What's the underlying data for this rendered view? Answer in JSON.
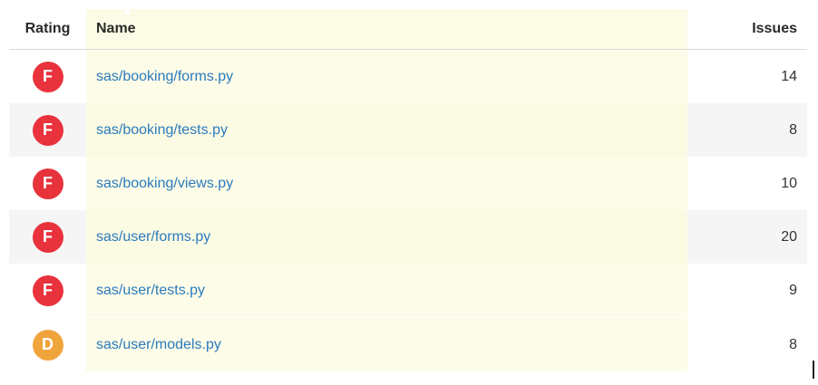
{
  "header": {
    "rating": "Rating",
    "name": "Name",
    "issues": "Issues"
  },
  "rows": [
    {
      "rating": "F",
      "rating_color": "#e8323c",
      "name": "sas/booking/forms.py",
      "issues": "14"
    },
    {
      "rating": "F",
      "rating_color": "#e8323c",
      "name": "sas/booking/tests.py",
      "issues": "8"
    },
    {
      "rating": "F",
      "rating_color": "#e8323c",
      "name": "sas/booking/views.py",
      "issues": "10"
    },
    {
      "rating": "F",
      "rating_color": "#e8323c",
      "name": "sas/user/forms.py",
      "issues": "20"
    },
    {
      "rating": "F",
      "rating_color": "#e8323c",
      "name": "sas/user/tests.py",
      "issues": "9"
    },
    {
      "rating": "D",
      "rating_color": "#f0a43c",
      "name": "sas/user/models.py",
      "issues": "8"
    }
  ]
}
